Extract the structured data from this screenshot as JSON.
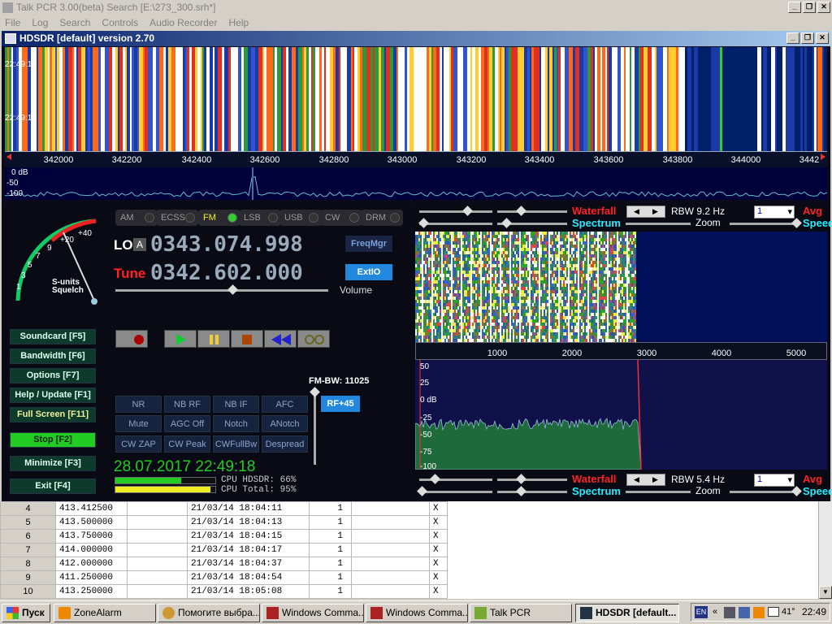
{
  "outer_window": {
    "title": "Talk PCR 3.00(beta) Search  [E:\\273_300.srh*]",
    "menu": [
      "File",
      "Log",
      "Search",
      "Controls",
      "Audio Recorder",
      "Help"
    ],
    "btn_minimize": "_",
    "btn_restore": "❐",
    "btn_close": "✕"
  },
  "hdsdr": {
    "title": "HDSDR [default]  version 2.70",
    "btn_minimize": "_",
    "btn_restore": "❐",
    "btn_close": "✕",
    "waterfall_times": [
      "22:49:14",
      "22:49:17"
    ],
    "ruler_labels": [
      "342000",
      "342200",
      "342400",
      "342600",
      "342800",
      "343000",
      "343200",
      "343400",
      "343600",
      "343800",
      "344000",
      "3442"
    ],
    "spectrum_scale": [
      "0 dB",
      "-50",
      "-100"
    ],
    "smeter": {
      "ticks": [
        "1",
        "3",
        "5",
        "7",
        "9",
        "+20",
        "+40"
      ],
      "label1": "S-units",
      "label2": "Squelch"
    },
    "modes": [
      {
        "label": "AM",
        "active": false
      },
      {
        "label": "ECSS",
        "active": false
      },
      {
        "label": "FM",
        "active": true
      },
      {
        "label": "LSB",
        "active": false
      },
      {
        "label": "USB",
        "active": false
      },
      {
        "label": "CW",
        "active": false
      },
      {
        "label": "DRM",
        "active": false
      }
    ],
    "lo_label": "LO",
    "lo_tag": "A",
    "lo_freq": "0343.074.998",
    "tune_label": "Tune",
    "tune_freq": "0342.602.000",
    "freqmgr": "FreqMgr",
    "extio": "ExtIO",
    "volume_label": "Volume",
    "left_buttons": [
      {
        "label": "Soundcard  [F5]"
      },
      {
        "label": "Bandwidth  [F6]"
      },
      {
        "label": "Options  [F7]"
      },
      {
        "label": "Help / Update  [F1]"
      },
      {
        "label": "Full Screen  [F11]"
      },
      {
        "label": "Stop  [F2]"
      },
      {
        "label": "Minimize  [F3]"
      },
      {
        "label": "Exit  [F4]"
      }
    ],
    "fm_bw": "FM-BW: 11025",
    "rf_button": "RF+45",
    "dsp_buttons": [
      [
        "NR",
        "NB RF",
        "NB IF",
        "AFC"
      ],
      [
        "Mute",
        "AGC Off",
        "Notch",
        "ANotch"
      ],
      [
        "CW ZAP",
        "CW Peak",
        "CWFullBw",
        "Despread"
      ]
    ],
    "datetime": "28.07.2017 22:49:18",
    "cpu_hdsdr": "CPU HDSDR: 66%",
    "cpu_total": "CPU Total: 95%",
    "cpu_hdsdr_level": 0.66,
    "cpu_total_level": 0.95,
    "audio_top": {
      "waterfall": "Waterfall",
      "spectrum": "Spectrum",
      "rbw": "RBW  9.2 Hz",
      "avg_value": "1",
      "avg": "Avg",
      "zoom": "Zoom",
      "speed": "Speed"
    },
    "audio_ruler": [
      "1000",
      "2000",
      "3000",
      "4000",
      "5000"
    ],
    "audio_spec_scale": [
      "50",
      "25",
      "0 dB",
      "-25",
      "-50",
      "-75",
      "-100"
    ],
    "audio_bottom": {
      "waterfall": "Waterfall",
      "spectrum": "Spectrum",
      "rbw": "RBW  5.4 Hz",
      "avg_value": "1",
      "avg": "Avg",
      "zoom": "Zoom",
      "speed": "Speed"
    }
  },
  "table": {
    "rows": [
      {
        "n": "4",
        "freq": "413.412500",
        "time": "21/03/14 18:04:11",
        "count": "1",
        "x": "X"
      },
      {
        "n": "5",
        "freq": "413.500000",
        "time": "21/03/14 18:04:13",
        "count": "1",
        "x": "X"
      },
      {
        "n": "6",
        "freq": "413.750000",
        "time": "21/03/14 18:04:15",
        "count": "1",
        "x": "X"
      },
      {
        "n": "7",
        "freq": "414.000000",
        "time": "21/03/14 18:04:17",
        "count": "1",
        "x": "X"
      },
      {
        "n": "8",
        "freq": "412.000000",
        "time": "21/03/14 18:04:37",
        "count": "1",
        "x": "X"
      },
      {
        "n": "9",
        "freq": "411.250000",
        "time": "21/03/14 18:04:54",
        "count": "1",
        "x": "X"
      },
      {
        "n": "10",
        "freq": "413.250000",
        "time": "21/03/14 18:05:08",
        "count": "1",
        "x": "X"
      }
    ]
  },
  "taskbar": {
    "start": "Пуск",
    "tasks": [
      {
        "label": "ZoneAlarm",
        "active": false
      },
      {
        "label": "Помогите выбра...",
        "active": false
      },
      {
        "label": "Windows Comma...",
        "active": false
      },
      {
        "label": "Windows Comma...",
        "active": false
      },
      {
        "label": "Talk PCR",
        "active": false
      },
      {
        "label": "HDSDR [default...",
        "active": true
      }
    ],
    "lang": "EN",
    "chevron": "«",
    "temp": "41°",
    "clock": "22:49"
  }
}
